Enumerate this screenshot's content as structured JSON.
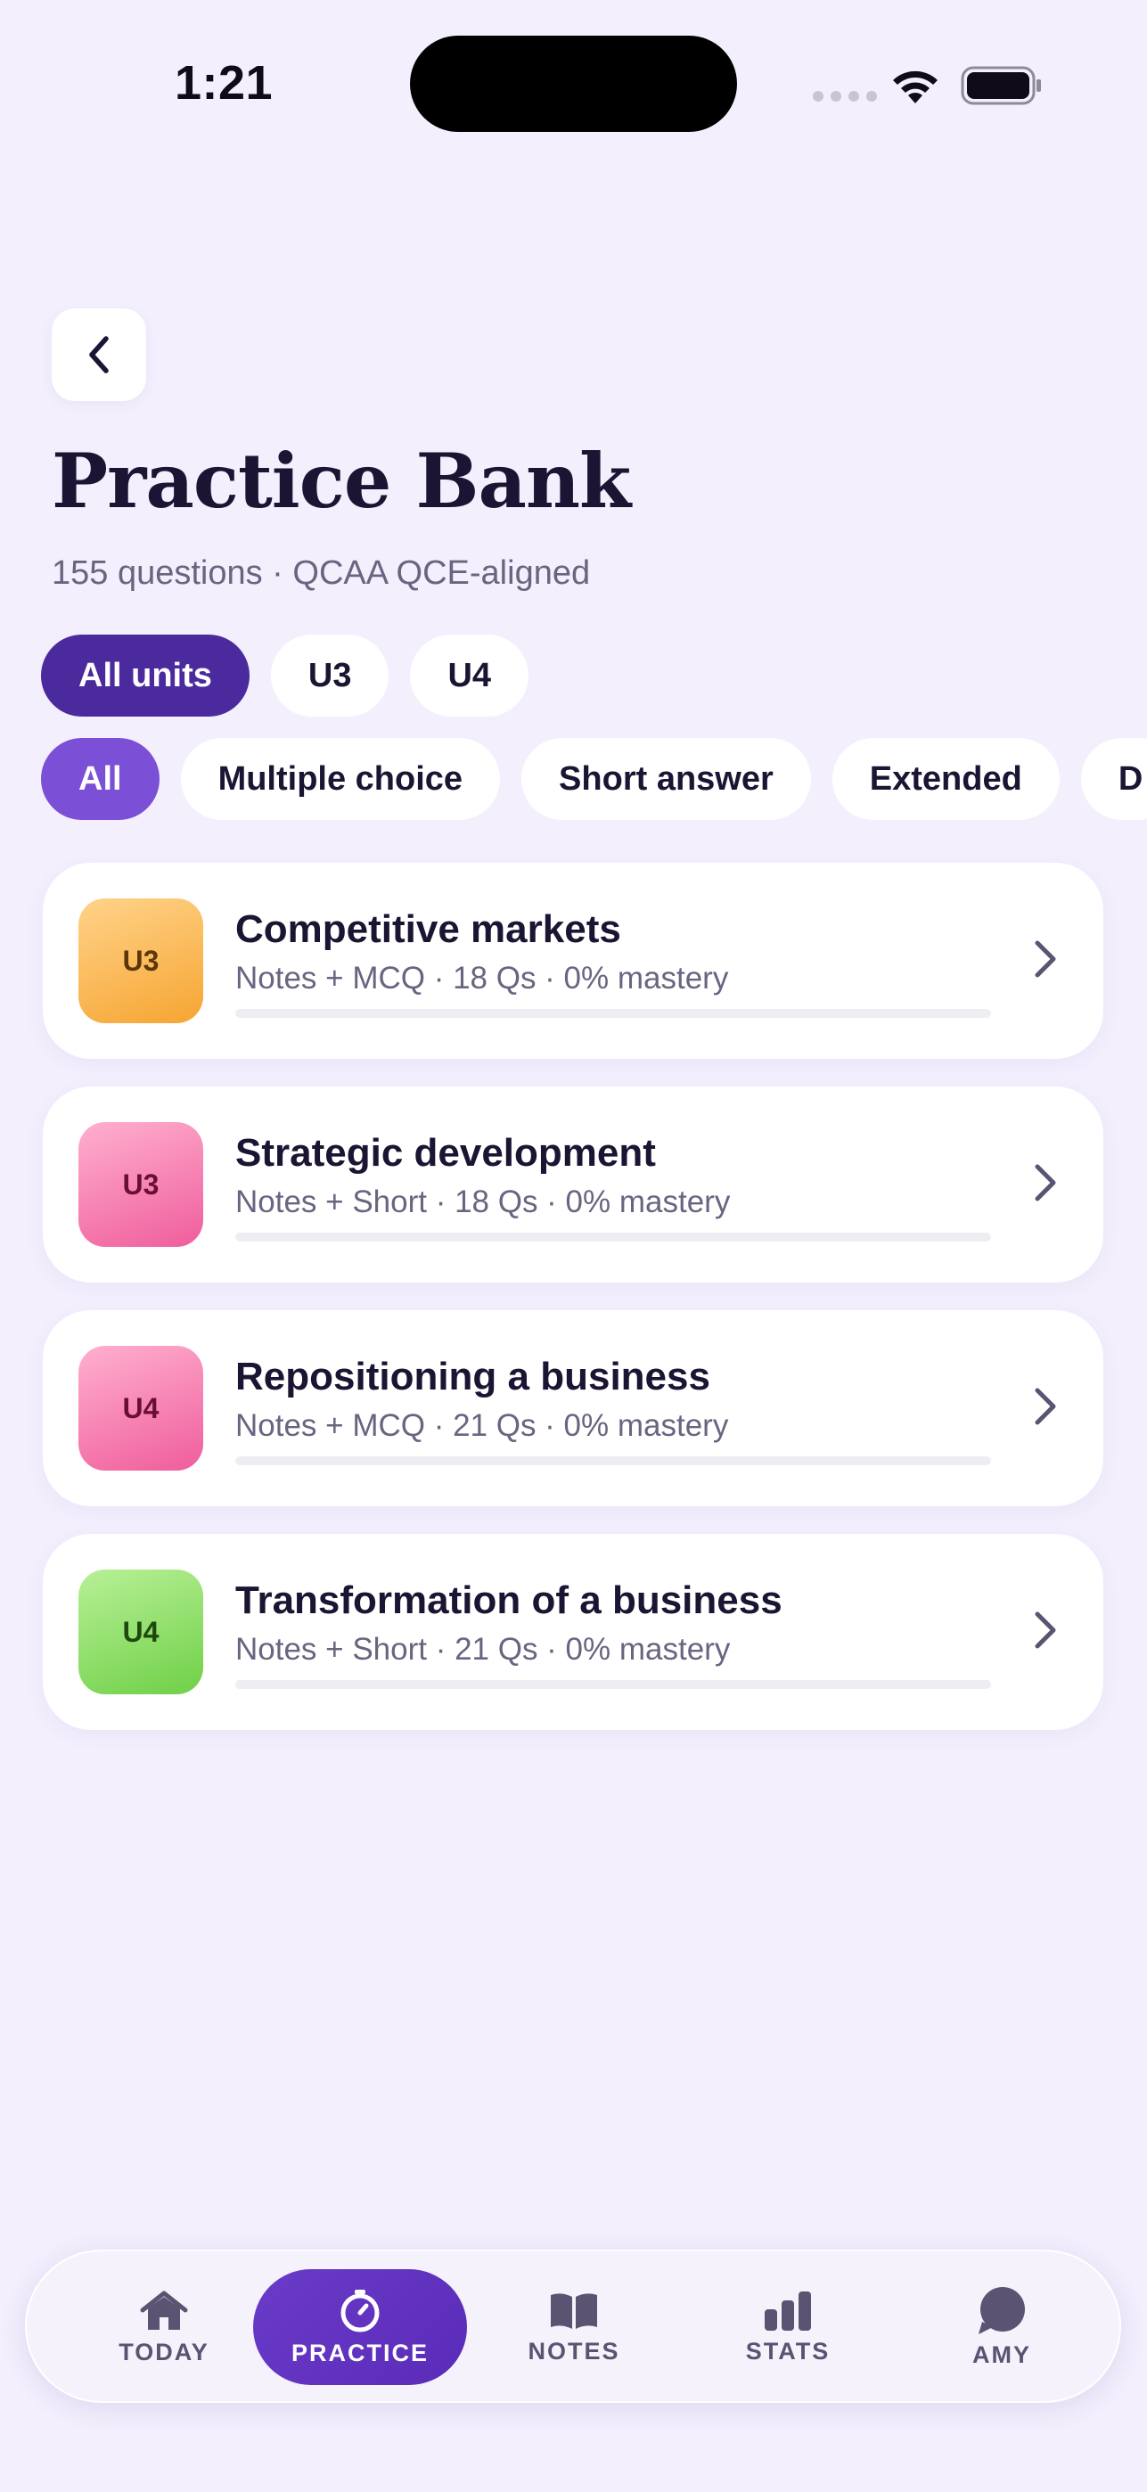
{
  "status": {
    "time": "1:21"
  },
  "header": {
    "title": "Practice Bank",
    "subtitle": "155 questions · QCAA QCE-aligned"
  },
  "unit_filters": [
    {
      "label": "All units",
      "selected": true
    },
    {
      "label": "U3",
      "selected": false
    },
    {
      "label": "U4",
      "selected": false
    }
  ],
  "type_filters": [
    {
      "label": "All",
      "selected": true
    },
    {
      "label": "Multiple choice",
      "selected": false
    },
    {
      "label": "Short answer",
      "selected": false
    },
    {
      "label": "Extended",
      "selected": false
    },
    {
      "label": "D",
      "selected": false
    }
  ],
  "topics": [
    {
      "unit": "U3",
      "title": "Competitive markets",
      "meta": "Notes + MCQ · 18 Qs · 0% mastery",
      "mastery": 0,
      "color": "#f6a532"
    },
    {
      "unit": "U3",
      "title": "Strategic development",
      "meta": "Notes + Short · 18 Qs · 0% mastery",
      "mastery": 0,
      "color": "#ef5d9c"
    },
    {
      "unit": "U4",
      "title": "Repositioning a business",
      "meta": "Notes + MCQ · 21 Qs · 0% mastery",
      "mastery": 0,
      "color": "#ef5d9c"
    },
    {
      "unit": "U4",
      "title": "Transformation of a business",
      "meta": "Notes + Short · 21 Qs · 0% mastery",
      "mastery": 0,
      "color": "#6fd047"
    }
  ],
  "tabs": [
    {
      "label": "TODAY",
      "icon": "home-icon",
      "active": false
    },
    {
      "label": "PRACTICE",
      "icon": "timer-icon",
      "active": true
    },
    {
      "label": "NOTES",
      "icon": "book-icon",
      "active": false
    },
    {
      "label": "STATS",
      "icon": "bar-chart-icon",
      "active": false
    },
    {
      "label": "AMY",
      "icon": "chat-bubble-icon",
      "active": false
    }
  ],
  "colors": {
    "background": "#f3effd",
    "accent_dark": "#4b2a9e",
    "accent": "#7b4fd6",
    "text": "#1c1433",
    "muted": "#6b6480"
  }
}
